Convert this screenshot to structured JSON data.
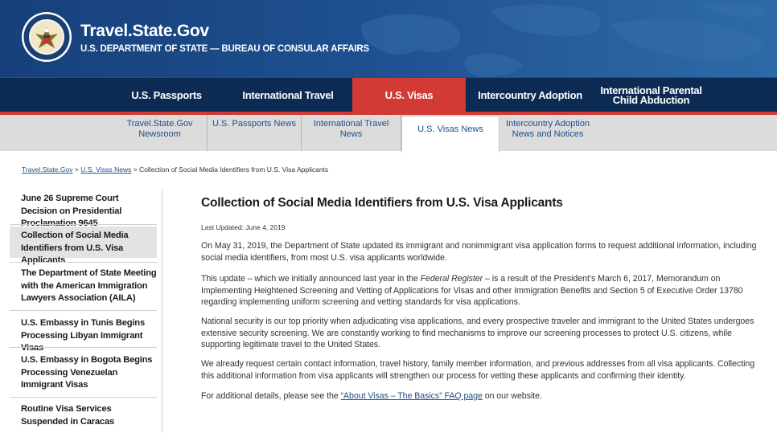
{
  "header": {
    "site_title": "Travel.State.Gov",
    "site_subtitle": "U.S. DEPARTMENT OF STATE — BUREAU OF CONSULAR AFFAIRS",
    "seal_icon": "dept-of-state-seal-icon"
  },
  "main_nav": {
    "items": [
      {
        "label": "U.S. Passports"
      },
      {
        "label": "International Travel"
      },
      {
        "label": "U.S. Visas"
      },
      {
        "label": "Intercountry Adoption"
      },
      {
        "label": "International Parental Child Abduction"
      }
    ],
    "active": "U.S. Visas"
  },
  "sub_nav": {
    "items": [
      {
        "label": "Travel.State.Gov Newsroom"
      },
      {
        "label": "U.S. Passports News"
      },
      {
        "label": "International Travel News"
      },
      {
        "label": "U.S. Visas News"
      },
      {
        "label": "Intercountry Adoption News and Notices"
      }
    ],
    "active": "U.S. Visas News"
  },
  "breadcrumb": {
    "home": "Travel.State.Gov",
    "section": "U.S. Visas News",
    "current": "Collection of Social Media Identifiers from U.S. Visa Applicants",
    "separator": ">"
  },
  "sidebar": {
    "items": [
      {
        "label": "June 26 Supreme Court Decision on Presidential Proclamation 9645"
      },
      {
        "label": "Collection of Social Media Identifiers from U.S. Visa Applicants"
      },
      {
        "label": "The Department of State Meeting with the American Immigration Lawyers Association (AILA)"
      },
      {
        "label": "U.S. Embassy in Tunis Begins Processing Libyan Immigrant Visas"
      },
      {
        "label": "U.S. Embassy in Bogota Begins Processing Venezuelan Immigrant Visas"
      },
      {
        "label": "Routine Visa Services Suspended in Caracas"
      }
    ]
  },
  "article": {
    "title": "Collection of Social Media Identifiers from U.S. Visa Applicants",
    "last_updated": "Last Updated: June 4, 2019",
    "p1": "On May 31, 2019, the Department of State updated its immigrant and nonimmigrant visa application forms to request additional information, including social media identifiers, from most U.S. visa applicants worldwide.",
    "p2_before": "This update – which we initially announced last year in the ",
    "p2_italic": "Federal Register",
    "p2_after": " – is a result of the President’s March 6, 2017, Memorandum on Implementing Heightened Screening and Vetting of Applications for Visas and other Immigration Benefits and Section 5 of Executive Order 13780 regarding implementing uniform screening and vetting standards for visa applications.",
    "p3": "National security is our top priority when adjudicating visa applications, and every prospective traveler and immigrant to the United States undergoes extensive security screening.  We are constantly working to find mechanisms to improve our screening processes to protect U.S. citizens, while supporting legitimate travel to the United States.",
    "p4": "We already request certain contact information, travel history, family member information, and previous addresses from all visa applicants.  Collecting this additional information from visa applicants will strengthen our process for vetting these applicants and confirming their identity.",
    "p5_before": "For additional details, please see the ",
    "p5_link": "“About Visas – The Basics” FAQ page",
    "p5_after": " on our website."
  },
  "colors": {
    "header_blue": "#1d4f8f",
    "nav_dark": "#0d2a52",
    "accent_red": "#d13a35",
    "link_blue": "#1f4e8a"
  }
}
